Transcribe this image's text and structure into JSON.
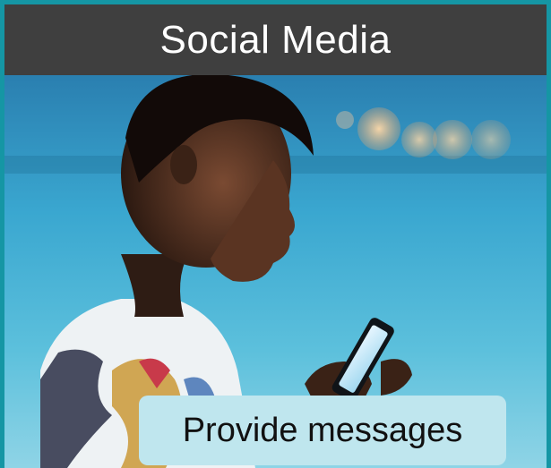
{
  "header": {
    "title": "Social Media"
  },
  "caption": {
    "text": "Provide messages"
  },
  "colors": {
    "frame": "#1596a4",
    "header_bg": "#3f3f3f",
    "header_text": "#ffffff",
    "caption_bg": "#bfe6ee",
    "caption_text": "#111111"
  }
}
